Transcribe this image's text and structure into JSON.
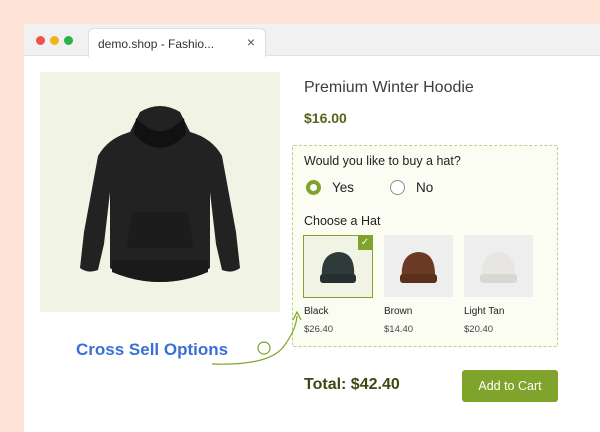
{
  "browser": {
    "tab_title": "demo.shop - Fashio...",
    "close_glyph": "×"
  },
  "product": {
    "title": "Premium Winter Hoodie",
    "price": "$16.00",
    "image_icon": "hoodie-image"
  },
  "cross_sell": {
    "question": "Would you like to buy a hat?",
    "options": [
      {
        "label": "Yes",
        "selected": true
      },
      {
        "label": "No",
        "selected": false
      }
    ],
    "choose_label": "Choose a Hat",
    "hats": [
      {
        "name": "Black",
        "price": "$26.40",
        "selected": true,
        "color": "#2f3a3a"
      },
      {
        "name": "Brown",
        "price": "$14.40",
        "selected": false,
        "color": "#6b3a24"
      },
      {
        "name": "Light Tan",
        "price": "$20.40",
        "selected": false,
        "color": "#e8e6e2"
      }
    ],
    "check_glyph": "✓"
  },
  "annotation": {
    "label": "Cross Sell Options"
  },
  "checkout": {
    "total": "Total: $42.40",
    "cart_label": "Add to Cart"
  },
  "colors": {
    "accent": "#7fa32b",
    "annotation": "#3a6fd8",
    "price": "#55641e"
  }
}
